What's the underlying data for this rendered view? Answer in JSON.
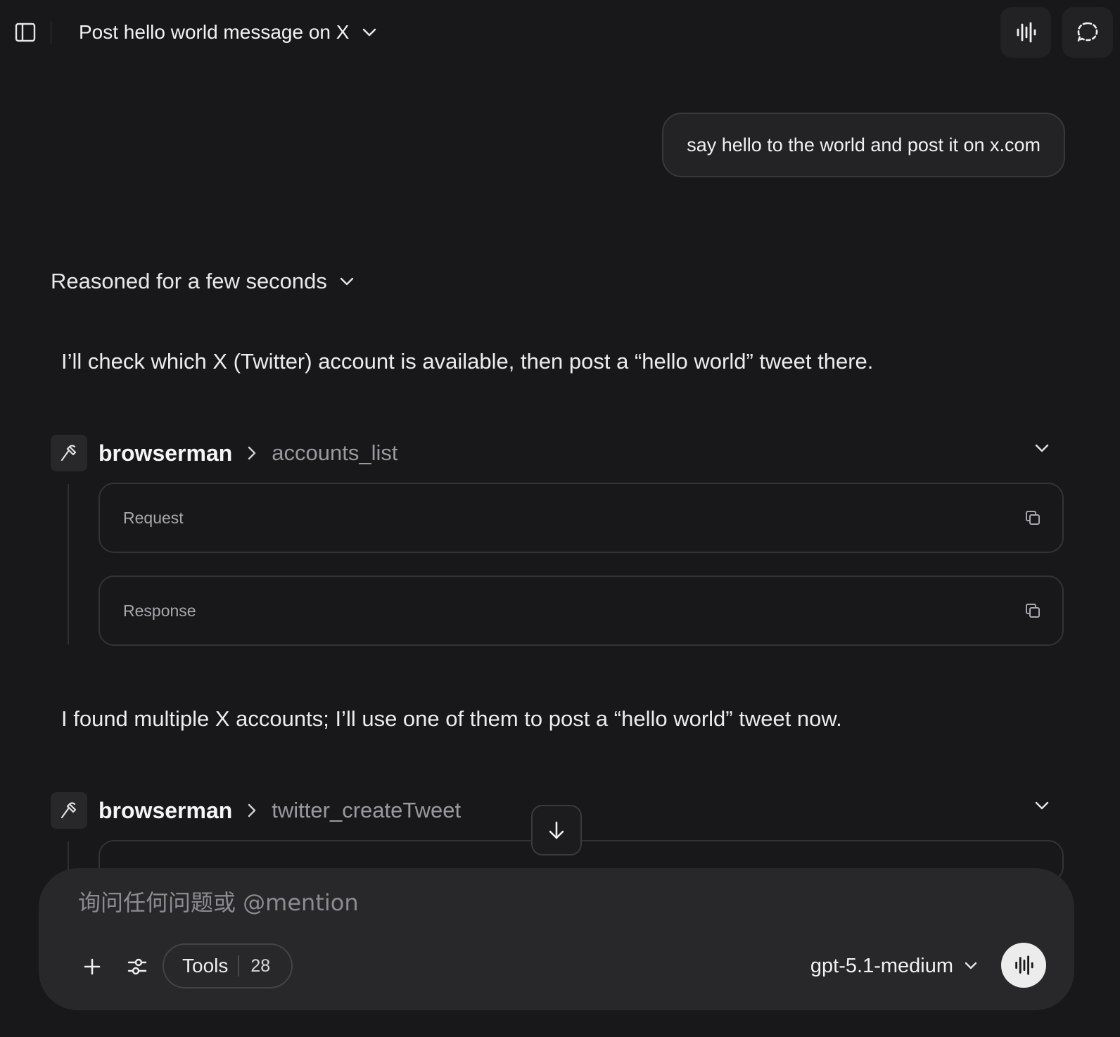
{
  "header": {
    "title": "Post hello world message on X"
  },
  "user_message": "say hello to the world and post it on x.com",
  "reasoning": {
    "label": "Reasoned for a few seconds"
  },
  "assistant_messages": [
    "I’ll check which X (Twitter) account is available, then post a “hello world” tweet there.",
    "I found multiple X accounts; I’ll use one of them to post a “hello world” tweet now."
  ],
  "tool_calls": [
    {
      "server": "browserman",
      "function": "accounts_list",
      "request_label": "Request",
      "response_label": "Response"
    },
    {
      "server": "browserman",
      "function": "twitter_createTweet"
    }
  ],
  "composer": {
    "placeholder": "询问任何问题或 @mention",
    "tools_label": "Tools",
    "tools_count": "28",
    "model": "gpt-5.1-medium"
  },
  "colors": {
    "background": "#18181a",
    "surface": "#28282b",
    "text": "#ececec",
    "muted": "#9a9a9e"
  }
}
